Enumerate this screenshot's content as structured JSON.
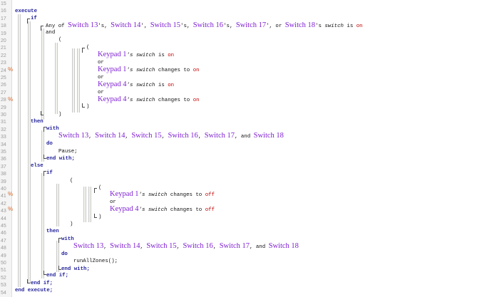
{
  "line_numbers": [
    "15",
    "16",
    "17",
    "18",
    "19",
    "20",
    "21",
    "22",
    "23",
    "24",
    "25",
    "26",
    "27",
    "28",
    "29",
    "30",
    "31",
    "32",
    "33",
    "34",
    "35",
    "36",
    "37",
    "38",
    "39",
    "40",
    "41",
    "42",
    "43",
    "44",
    "45",
    "46",
    "47",
    "48",
    "49",
    "50",
    "51",
    "52",
    "53",
    "54"
  ],
  "gutter_markers": {
    "24": "%",
    "28": "%",
    "41": "%",
    "43": "%"
  },
  "code": {
    "execute": "execute",
    "if": "if",
    "any_of": "Any of",
    "sw13": "Switch 13",
    "sw14": "Switch 14",
    "sw15": "Switch 15",
    "sw16": "Switch 16",
    "sw17": "Switch 17",
    "sw18": "Switch 18",
    "apos_s": "'s",
    "apos": "'",
    "comma": ",",
    "or": "or",
    "and": "and",
    "s_switch": "'s switch",
    "switch_word": "switch",
    "is": "is",
    "on": "on",
    "off": "off",
    "changes_to": "changes to",
    "open_paren": "(",
    "close_paren": ")",
    "keypad1": "Keypad 1",
    "keypad4": "Keypad 4",
    "then": "then",
    "with": "with",
    "do": "do",
    "pause": "Pause;",
    "end_with": "end with;",
    "else": "else",
    "run_all": "runAllZones();",
    "end_if": "end if;",
    "end_execute": "end execute;"
  }
}
